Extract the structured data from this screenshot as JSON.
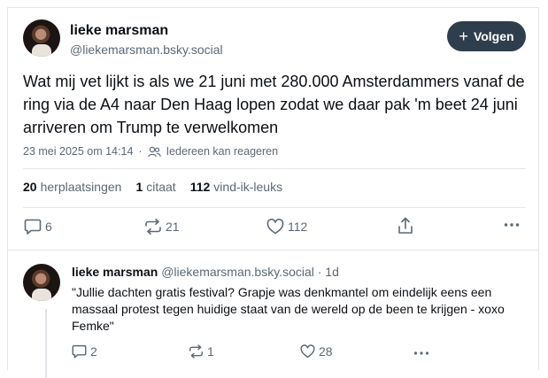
{
  "post": {
    "author_name": "lieke marsman",
    "author_handle": "@liekemarsman.bsky.social",
    "follow_label": "Volgen",
    "text": "Wat mij vet lijkt is als we 21 juni met 280.000 Amsterdammers vanaf de ring via de A4 naar Den Haag lopen zodat we daar pak 'm beet 24 juni arriveren om Trump te verwelkomen",
    "timestamp": "23 mei 2025 om 14:14",
    "reply_setting": "Iedereen kan reageren",
    "stats": {
      "reposts_count": "20",
      "reposts_label": "herplaatsingen",
      "quotes_count": "1",
      "quotes_label": "citaat",
      "likes_count": "112",
      "likes_label": "vind-ik-leuks"
    },
    "actions": {
      "reply_count": "6",
      "repost_count": "21",
      "like_count": "112"
    }
  },
  "reply": {
    "author_name": "lieke marsman",
    "author_handle": "@liekemarsman.bsky.social",
    "age": "· 1d",
    "text": "\"Jullie dachten gratis festival? Grapje was denkmantel om eindelijk eens een massaal protest tegen huidige staat van de wereld op de been te krijgen - xoxo Femke\"",
    "actions": {
      "reply_count": "2",
      "repost_count": "1",
      "like_count": "28"
    }
  },
  "colors": {
    "accent": "#2f3e4c",
    "muted": "#5b6874",
    "divider": "#e3e7eb"
  }
}
